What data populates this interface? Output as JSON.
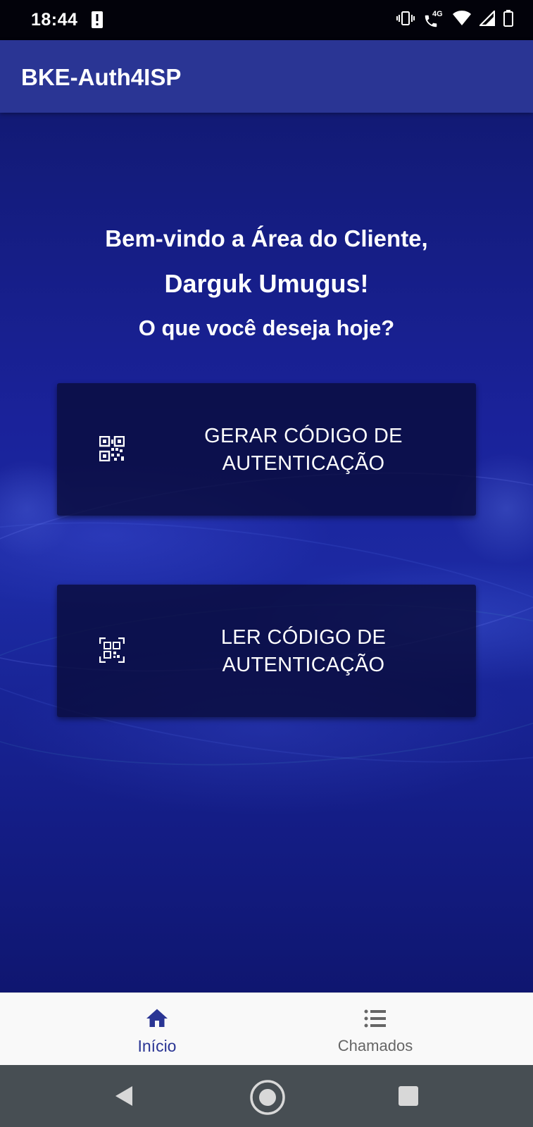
{
  "status_bar": {
    "time": "18:44",
    "icons": [
      "alert-icon",
      "vibrate-icon",
      "wifi-calling-icon",
      "wifi-icon",
      "signal-icon",
      "battery-icon"
    ],
    "network_label": "4G"
  },
  "app_bar": {
    "title": "BKE-Auth4ISP"
  },
  "welcome": {
    "line1": "Bem-vindo a Área do Cliente,",
    "name": "Darguk Umugus!",
    "question": "O que você deseja hoje?"
  },
  "actions": {
    "generate": {
      "label": "GERAR CÓDIGO DE\nAUTENTICAÇÃO",
      "icon": "qr-code-icon"
    },
    "read": {
      "label": "LER CÓDIGO DE\nAUTENTICAÇÃO",
      "icon": "qr-scan-icon"
    }
  },
  "bottom_nav": {
    "items": [
      {
        "label": "Início",
        "icon": "home-icon",
        "active": true
      },
      {
        "label": "Chamados",
        "icon": "list-icon",
        "active": false
      }
    ]
  },
  "colors": {
    "accent": "#2a3594",
    "background": "#1a229a",
    "button": "#0a0c3c",
    "nav_inactive": "#666666",
    "system_nav": "#474e53"
  }
}
